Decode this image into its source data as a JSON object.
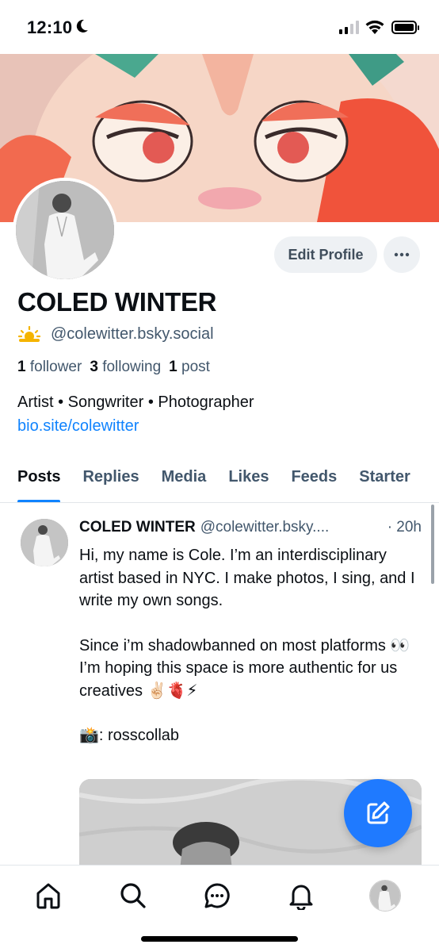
{
  "status_bar": {
    "time": "12:10",
    "icons": [
      "moon-icon",
      "signal-icon",
      "wifi-icon",
      "battery-icon"
    ]
  },
  "profile": {
    "display_name": "COLED WINTER",
    "handle": "@colewitter.bsky.social",
    "handle_emoji": "sun-behind-cloud-icon",
    "followers_count": "1",
    "followers_label": "follower",
    "following_count": "3",
    "following_label": "following",
    "posts_count": "1",
    "posts_label": "post",
    "bio": "Artist • Songwriter • Photographer",
    "link": "bio.site/colewitter",
    "edit_button": "Edit Profile",
    "more_button": "···"
  },
  "tabs": [
    {
      "label": "Posts",
      "active": true
    },
    {
      "label": "Replies",
      "active": false
    },
    {
      "label": "Media",
      "active": false
    },
    {
      "label": "Likes",
      "active": false
    },
    {
      "label": "Feeds",
      "active": false
    },
    {
      "label": "Starter",
      "active": false
    }
  ],
  "post": {
    "author": "COLED WINTER",
    "handle": "@colewitter.bsky....",
    "time": "· 20h",
    "paragraphs": [
      "Hi, my name is Cole. I’m an interdisciplinary artist based in NYC. I make photos, I sing, and I write my own songs.",
      "Since i’m shadowbanned on most platforms 👀 I’m hoping this space is more authentic for us creatives ✌🏻🫀⚡",
      "📸: rosscollab"
    ]
  },
  "colors": {
    "accent": "#1083fe",
    "fab": "#1f7aff",
    "muted_text": "#42576c",
    "button_bg": "#eef1f4"
  },
  "nav": [
    "home-icon",
    "search-icon",
    "chat-icon",
    "bell-icon",
    "profile-avatar"
  ]
}
